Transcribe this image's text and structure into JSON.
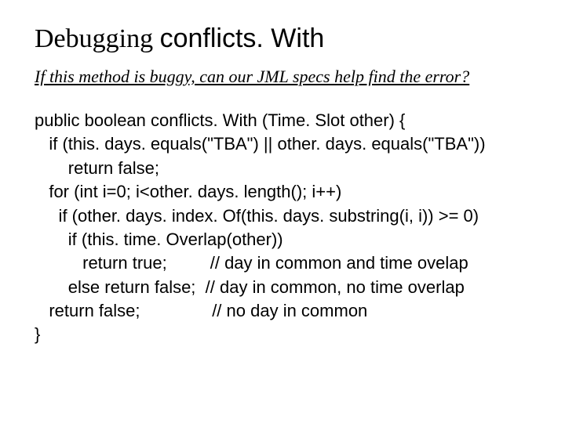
{
  "title": {
    "part1": "Debugging ",
    "part2": "conflicts. With"
  },
  "subtitle": "If this method is buggy, can our JML specs help find the error?",
  "code": {
    "l0": "public boolean conflicts. With (Time. Slot other) {",
    "l1": "   if (this. days. equals(\"TBA\") || other. days. equals(\"TBA\"))",
    "l2": "       return false;",
    "l3": "   for (int i=0; i<other. days. length(); i++)",
    "l4": "     if (other. days. index. Of(this. days. substring(i, i)) >= 0)",
    "l5": "       if (this. time. Overlap(other))",
    "l6": "          return true;         // day in common and time ovelap",
    "l7": "       else return false;  // day in common, no time overlap",
    "l8": "   return false;               // no day in common",
    "l9": "}"
  }
}
